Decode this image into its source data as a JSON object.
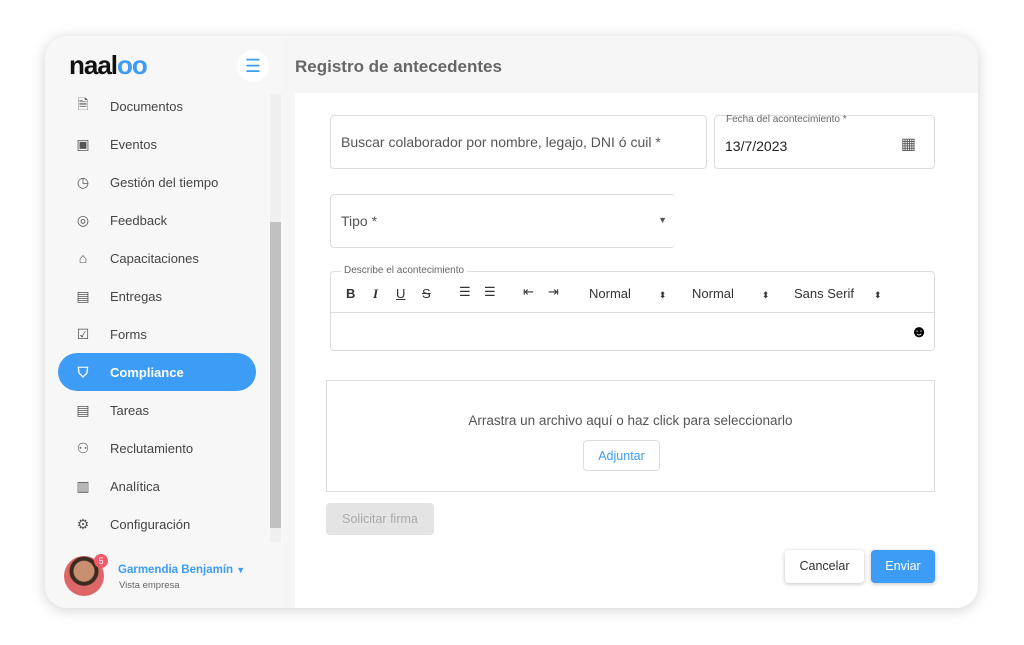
{
  "brand": {
    "logo_text": "naaloo"
  },
  "header": {
    "title": "Registro de antecedentes"
  },
  "sidebar": {
    "items": [
      {
        "label": "Documentos",
        "icon": "document-icon"
      },
      {
        "label": "Eventos",
        "icon": "calendar-icon"
      },
      {
        "label": "Gestión del tiempo",
        "icon": "clock-icon"
      },
      {
        "label": "Feedback",
        "icon": "feedback-icon"
      },
      {
        "label": "Capacitaciones",
        "icon": "graduation-cap-icon"
      },
      {
        "label": "Entregas",
        "icon": "archive-icon"
      },
      {
        "label": "Forms",
        "icon": "form-icon"
      },
      {
        "label": "Compliance",
        "icon": "shield-icon",
        "active": true
      },
      {
        "label": "Tareas",
        "icon": "list-icon"
      },
      {
        "label": "Reclutamiento",
        "icon": "people-search-icon"
      },
      {
        "label": "Analítica",
        "icon": "chart-icon"
      },
      {
        "label": "Configuración",
        "icon": "gear-icon"
      }
    ]
  },
  "user": {
    "name": "Garmendia Benjamín",
    "role": "Vista empresa",
    "notifications": "5"
  },
  "form": {
    "search_placeholder": "Buscar colaborador por nombre, legajo, DNI ó cuil *",
    "date_label": "Fecha del acontecimiento *",
    "date_value": "13/7/2023",
    "type_placeholder": "Tipo *",
    "editor_label": "Describe el acontecimiento",
    "toolbar": {
      "b": "B",
      "i": "I",
      "u": "U",
      "s": "S",
      "size": "Normal",
      "heading": "Normal",
      "font": "Sans Serif"
    },
    "dropzone_text": "Arrastra un archivo aquí o haz click para seleccionarlo",
    "attach_label": "Adjuntar",
    "sign_label": "Solicitar firma",
    "cancel_label": "Cancelar",
    "submit_label": "Enviar"
  },
  "colors": {
    "accent": "#3d9cf5"
  }
}
